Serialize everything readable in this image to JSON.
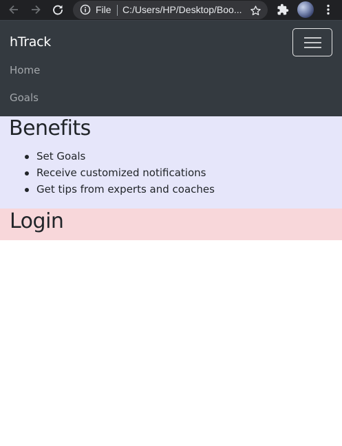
{
  "browser": {
    "omnibox": {
      "scheme_label": "File",
      "url": "C:/Users/HP/Desktop/Boo..."
    },
    "icons": {
      "back": "back-arrow-icon",
      "forward": "forward-arrow-icon",
      "reload": "reload-icon",
      "info": "info-icon",
      "bookmark": "star-icon",
      "extensions": "puzzle-icon",
      "menu": "kebab-menu-icon"
    }
  },
  "navbar": {
    "brand": "hTrack",
    "links": [
      {
        "label": "Home"
      },
      {
        "label": "Goals"
      }
    ],
    "toggler_icon": "hamburger-icon",
    "background": "#343a40"
  },
  "benefits": {
    "heading": "Benefits",
    "items": [
      {
        "label": "Set Goals"
      },
      {
        "label": "Receive customized notifications"
      },
      {
        "label": "Get tips from experts and coaches"
      }
    ],
    "background": "#e6e6fa"
  },
  "login": {
    "heading": "Login",
    "background": "#f8d7da"
  }
}
